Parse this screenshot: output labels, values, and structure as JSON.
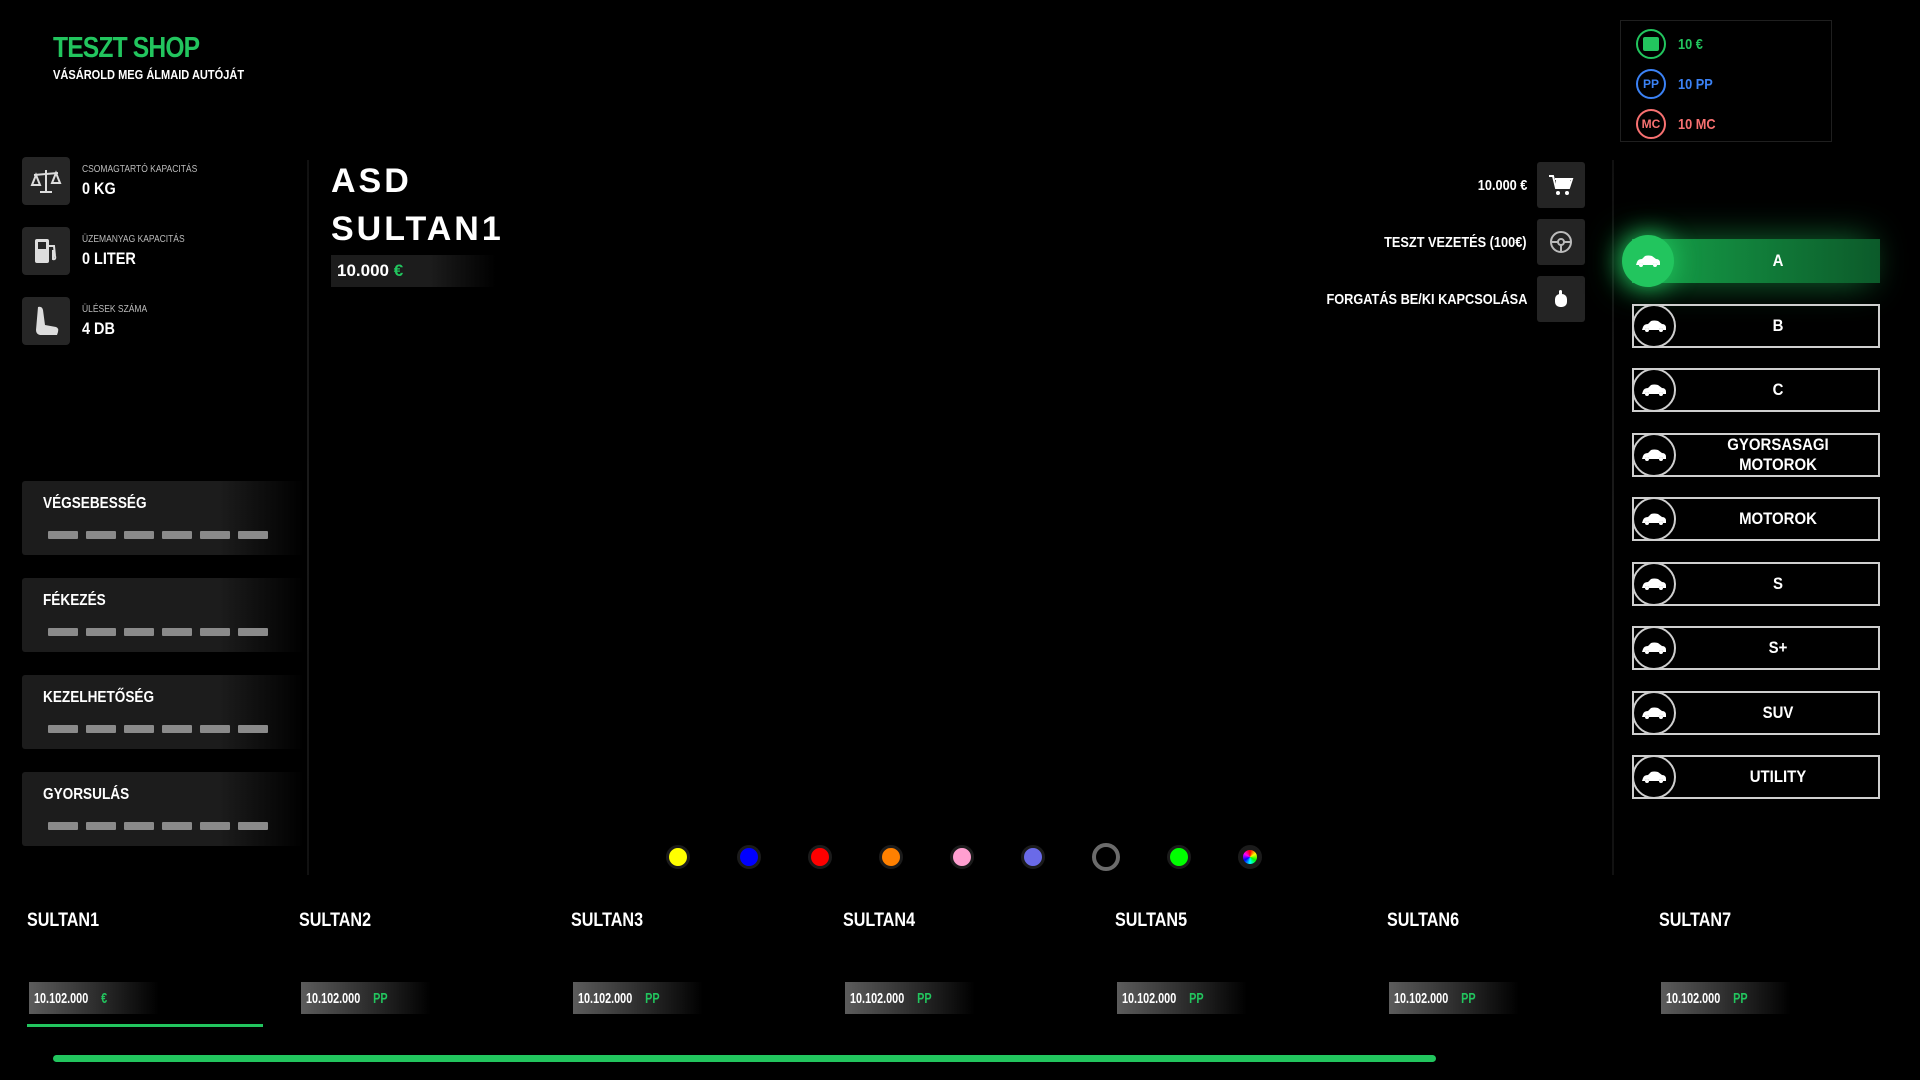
{
  "header": {
    "title": "TESZT SHOP",
    "subtitle": "VÁSÁROLD MEG ÁLMAID AUTÓJÁT"
  },
  "wallet": [
    {
      "icon": "cash-icon",
      "symbol": "",
      "value": "10 €",
      "color": "#22c55e"
    },
    {
      "icon": "pp-icon",
      "symbol": "PP",
      "value": "10 PP",
      "color": "#3b82f6"
    },
    {
      "icon": "mc-icon",
      "symbol": "MC",
      "value": "10 MC",
      "color": "#f87171"
    }
  ],
  "stats": [
    {
      "icon": "scale-icon",
      "label": "CSOMAGTARTÓ KAPACITÁS",
      "value": "0 KG"
    },
    {
      "icon": "fuel-icon",
      "label": "ÜZEMANYAG KAPACITÁS",
      "value": "0 LITER"
    },
    {
      "icon": "seat-icon",
      "label": "ÜLÉSEK SZÁMA",
      "value": "4 DB"
    }
  ],
  "performance": [
    {
      "label": "VÉGSEBESSÉG",
      "level": 6
    },
    {
      "label": "FÉKEZÉS",
      "level": 6
    },
    {
      "label": "KEZELHETŐSÉG",
      "level": 6
    },
    {
      "label": "GYORSULÁS",
      "level": 6
    }
  ],
  "vehicle": {
    "brand": "ASD",
    "model": "SULTAN1",
    "price": "10.000",
    "currency": "€"
  },
  "actions": [
    {
      "label": "10.000 €",
      "icon": "cart-icon"
    },
    {
      "label": "TESZT VEZETÉS (100€)",
      "icon": "steering-wheel-icon"
    },
    {
      "label": "FORGATÁS BE/KI KAPCSOLÁSA",
      "icon": "mouse-icon"
    }
  ],
  "categories": [
    {
      "label": "A",
      "active": true
    },
    {
      "label": "B",
      "active": false
    },
    {
      "label": "C",
      "active": false
    },
    {
      "label": "GYORSASAGI MOTOROK",
      "active": false
    },
    {
      "label": "MOTOROK",
      "active": false
    },
    {
      "label": "S",
      "active": false
    },
    {
      "label": "S+",
      "active": false
    },
    {
      "label": "SUV",
      "active": false
    },
    {
      "label": "UTILITY",
      "active": false
    }
  ],
  "colors": [
    "#ffff00",
    "#0000ff",
    "#ff0000",
    "#ff8000",
    "#ff9fd0",
    "#6a6ae8",
    "#000000",
    "#00ff00",
    "rainbow"
  ],
  "vehicles": [
    {
      "name": "SULTAN1",
      "price": "10.102.000",
      "currency": "€",
      "selected": true
    },
    {
      "name": "SULTAN2",
      "price": "10.102.000",
      "currency": "PP",
      "selected": false
    },
    {
      "name": "SULTAN3",
      "price": "10.102.000",
      "currency": "PP",
      "selected": false
    },
    {
      "name": "SULTAN4",
      "price": "10.102.000",
      "currency": "PP",
      "selected": false
    },
    {
      "name": "SULTAN5",
      "price": "10.102.000",
      "currency": "PP",
      "selected": false
    },
    {
      "name": "SULTAN6",
      "price": "10.102.000",
      "currency": "PP",
      "selected": false
    },
    {
      "name": "SULTAN7",
      "price": "10.102.000",
      "currency": "PP",
      "selected": false
    }
  ]
}
